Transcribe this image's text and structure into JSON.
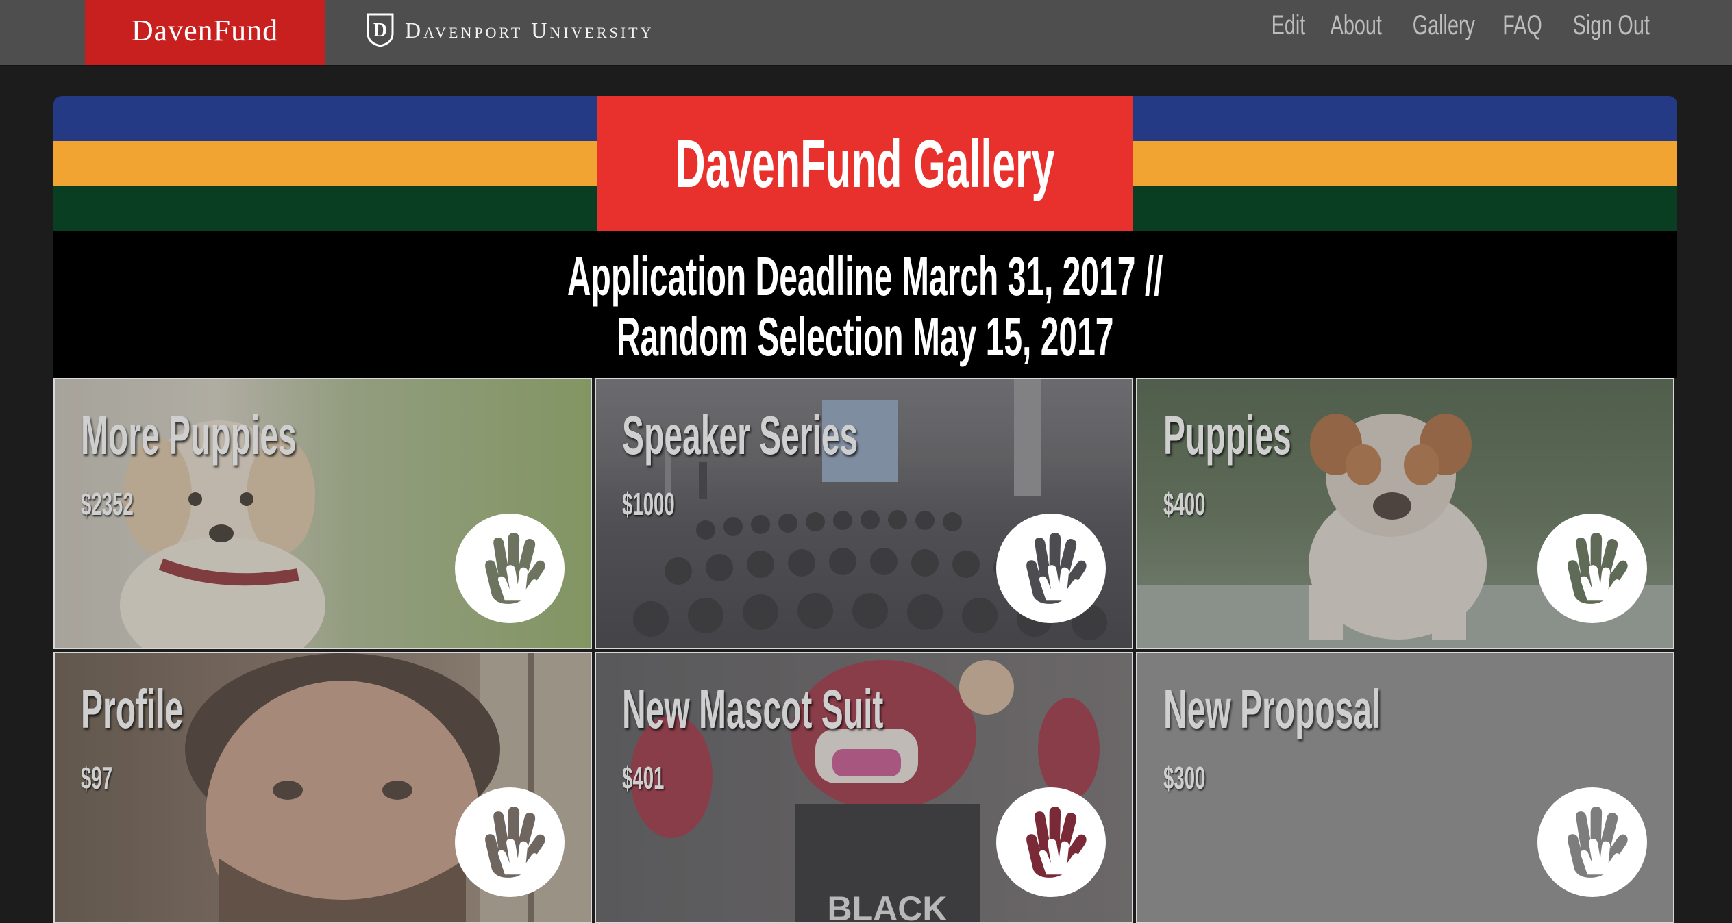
{
  "header": {
    "logo": "DavenFund",
    "university": "Davenport University",
    "nav": [
      "Edit",
      "About",
      "Gallery",
      "FAQ",
      "Sign Out"
    ]
  },
  "banner": {
    "title": "DavenFund Gallery",
    "deadline_line1": "Application Deadline March 31, 2017 //",
    "deadline_line2": "Random Selection May 15, 2017"
  },
  "tiles": [
    {
      "title": "More Puppies",
      "amount": "$2352",
      "image": "golden-puppy-photo"
    },
    {
      "title": "Speaker Series",
      "amount": "$1000",
      "image": "lecture-hall-photo"
    },
    {
      "title": "Puppies",
      "amount": "$400",
      "image": "bulldog-puppy-photo"
    },
    {
      "title": "Profile",
      "amount": "$97",
      "image": "bearded-man-photo"
    },
    {
      "title": "New Mascot Suit",
      "amount": "$401",
      "image": "red-mascot-photo"
    },
    {
      "title": "New Proposal",
      "amount": "$300",
      "image": "none"
    }
  ],
  "colors": {
    "brand_red": "#c8201f",
    "title_red": "#e8312d",
    "stripe_blue": "#243a84",
    "stripe_orange": "#f2a432",
    "stripe_green": "#0a3e22"
  }
}
